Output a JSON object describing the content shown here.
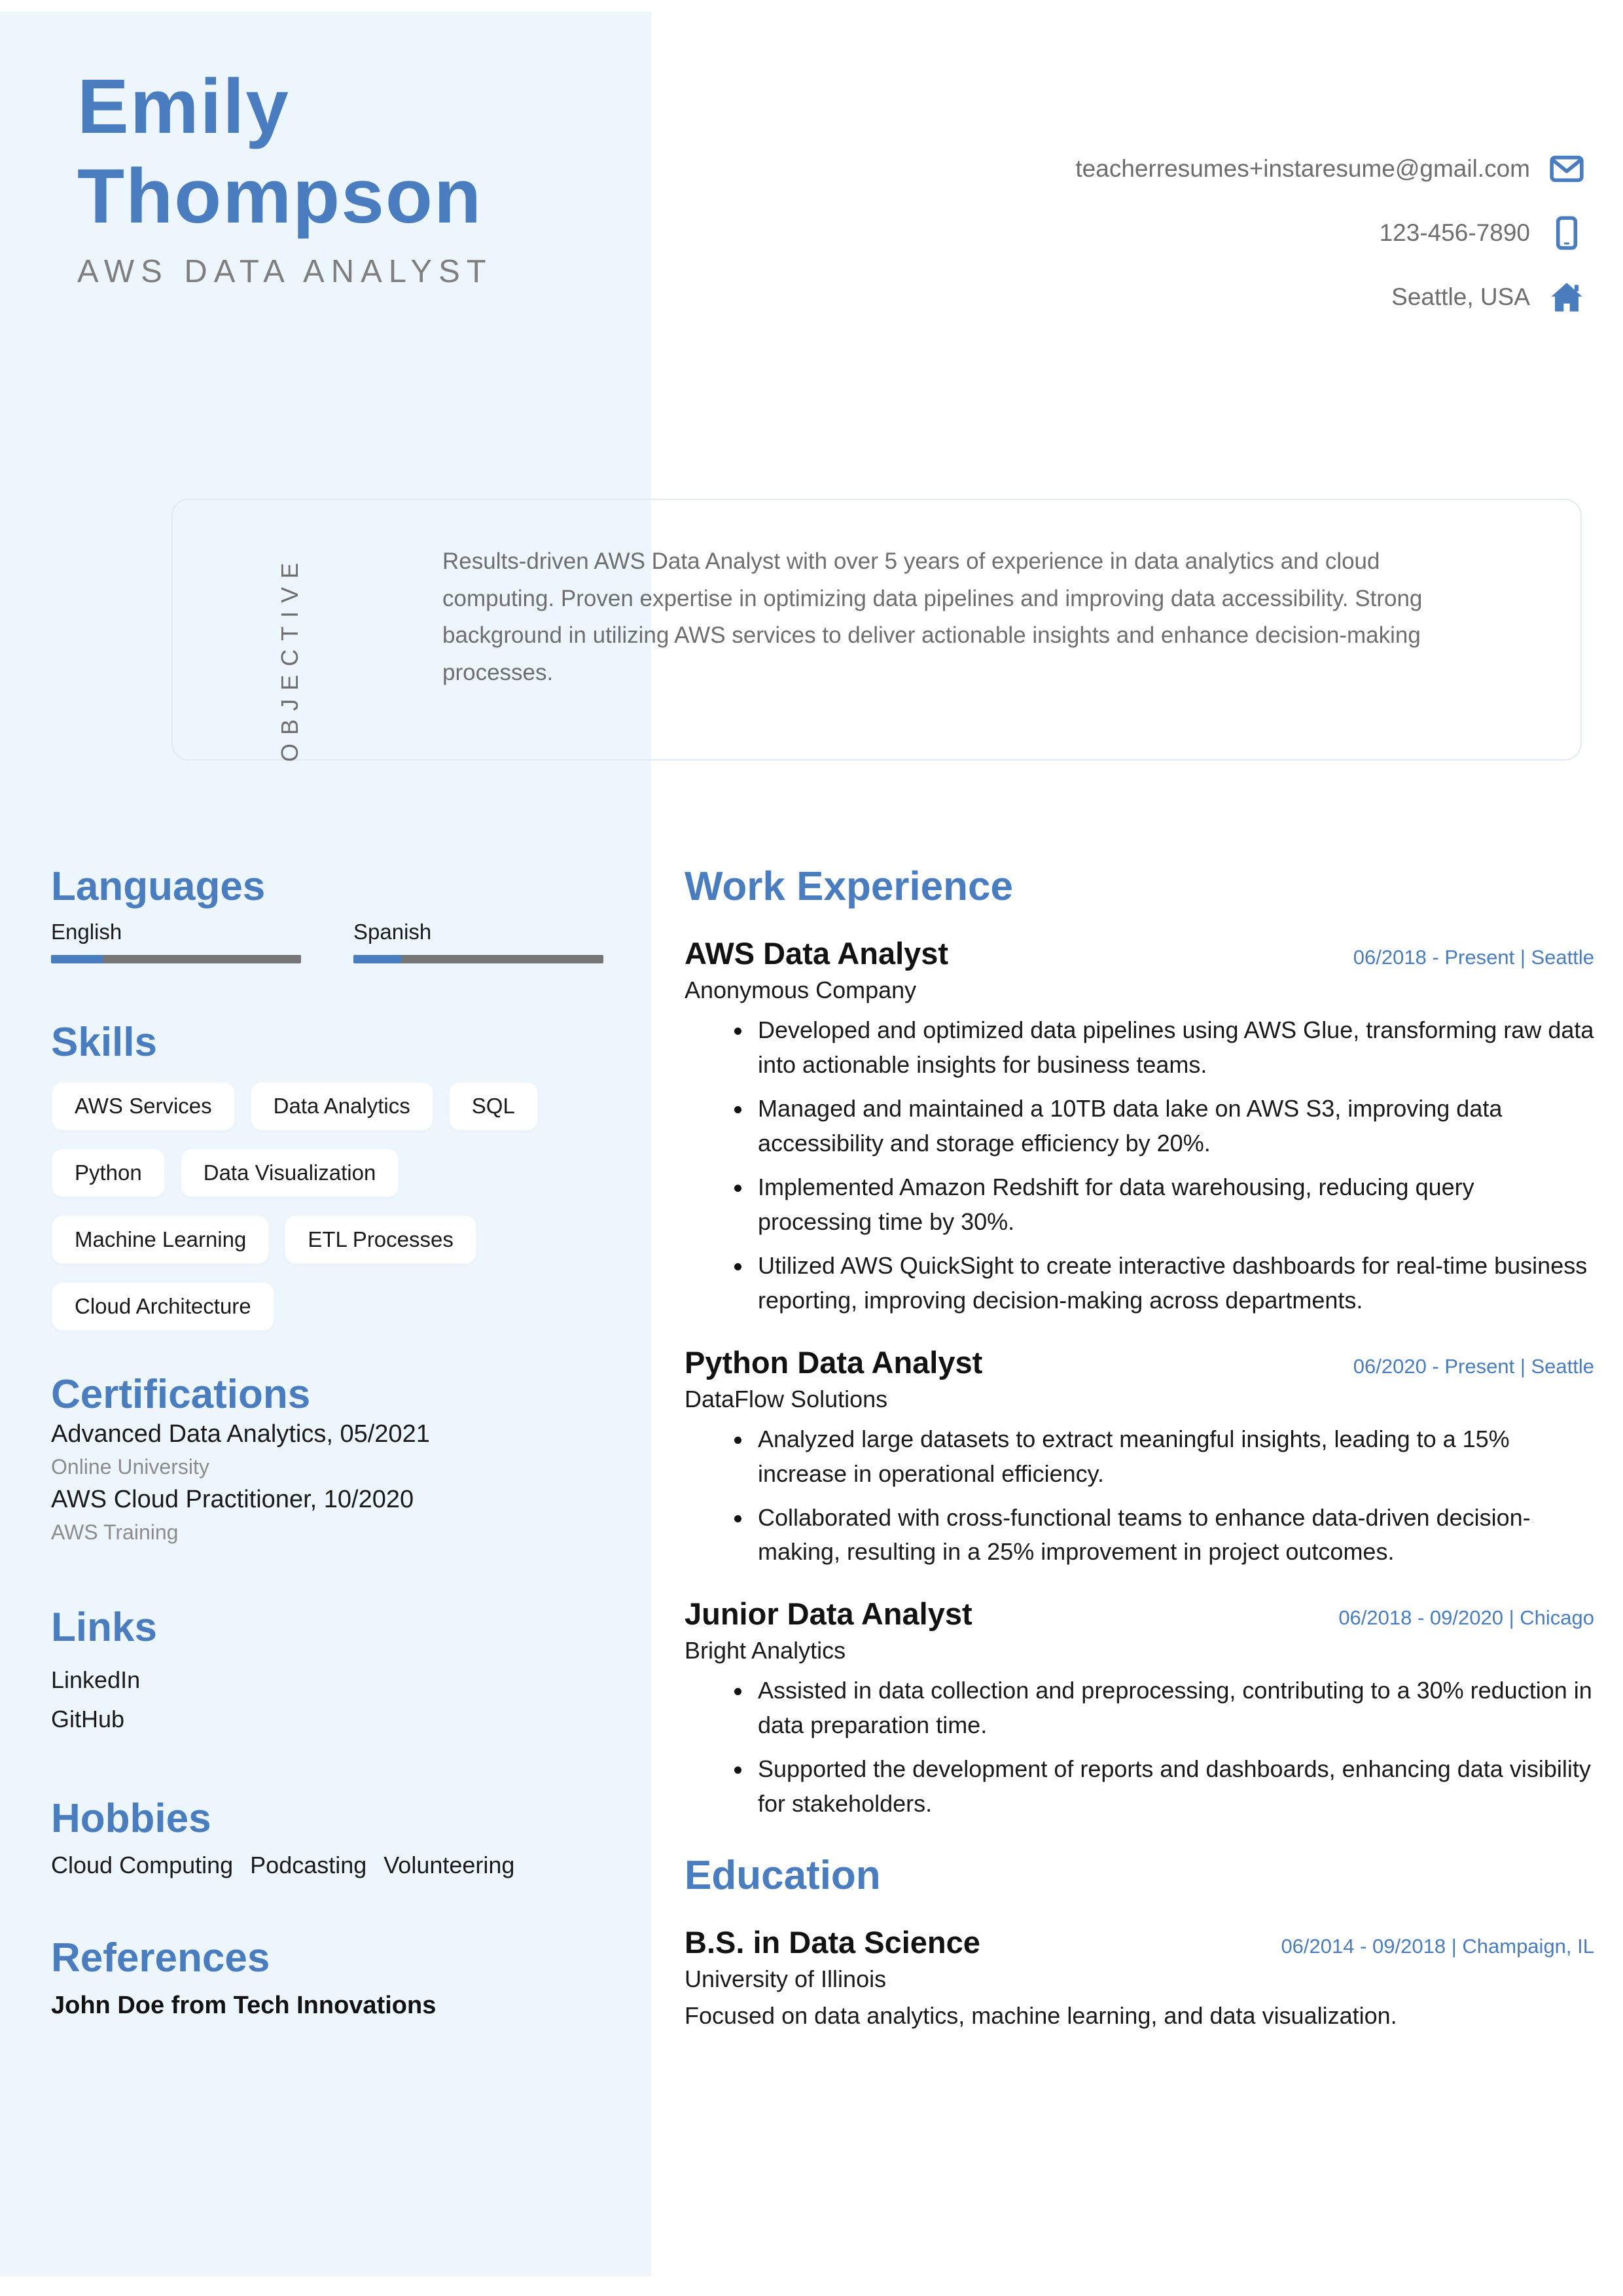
{
  "theme": {
    "accent": "#4a7dbf",
    "sidebar_bg": "#eef6fd",
    "muted_text": "#6e6e6e",
    "bar_track": "#767676"
  },
  "header": {
    "first_name": "Emily",
    "last_name": "Thompson",
    "job_title": "AWS DATA ANALYST",
    "contact": [
      {
        "icon": "envelope-icon",
        "text": "teacherresumes+instaresume@gmail.com"
      },
      {
        "icon": "mobile-phone-icon",
        "text": "123-456-7890"
      },
      {
        "icon": "home-icon",
        "text": "Seattle, USA"
      }
    ]
  },
  "objective": {
    "label": "OBJECTIVE",
    "text": "Results-driven AWS Data Analyst with over 5 years of experience in data analytics and cloud computing. Proven expertise in optimizing data pipelines and improving data accessibility. Strong background in utilizing AWS services to deliver actionable insights and enhance decision-making processes."
  },
  "sidebar": {
    "languages": {
      "heading": "Languages",
      "items": [
        {
          "name": "English",
          "level_percent": 21
        },
        {
          "name": "Spanish",
          "level_percent": 19
        }
      ]
    },
    "skills": {
      "heading": "Skills",
      "items": [
        "AWS Services",
        "Data Analytics",
        "SQL",
        "Python",
        "Data Visualization",
        "Machine Learning",
        "ETL Processes",
        "Cloud Architecture"
      ]
    },
    "certifications": {
      "heading": "Certifications",
      "items": [
        {
          "title": "Advanced Data Analytics, 05/2021",
          "org": "Online University"
        },
        {
          "title": "AWS Cloud Practitioner, 10/2020",
          "org": "AWS Training"
        }
      ]
    },
    "links": {
      "heading": "Links",
      "items": [
        "LinkedIn",
        "GitHub"
      ]
    },
    "hobbies": {
      "heading": "Hobbies",
      "items": [
        "Cloud Computing",
        "Podcasting",
        "Volunteering"
      ]
    },
    "references": {
      "heading": "References",
      "items": [
        "John Doe from Tech Innovations"
      ]
    }
  },
  "main": {
    "work": {
      "heading": "Work Experience",
      "jobs": [
        {
          "role": "AWS Data Analyst",
          "meta": "06/2018 - Present | Seattle",
          "company": "Anonymous Company",
          "bullets": [
            "Developed and optimized data pipelines using AWS Glue, transforming raw data into actionable insights for business teams.",
            "Managed and maintained a 10TB data lake on AWS S3, improving data accessibility and storage efficiency by 20%.",
            "Implemented Amazon Redshift for data warehousing, reducing query processing time by 30%.",
            "Utilized AWS QuickSight to create interactive dashboards for real-time business reporting, improving decision-making across departments."
          ]
        },
        {
          "role": "Python Data Analyst",
          "meta": "06/2020 - Present | Seattle",
          "company": "DataFlow Solutions",
          "bullets": [
            "Analyzed large datasets to extract meaningful insights, leading to a 15% increase in operational efficiency.",
            "Collaborated with cross-functional teams to enhance data-driven decision-making, resulting in a 25% improvement in project outcomes."
          ]
        },
        {
          "role": "Junior Data Analyst",
          "meta": "06/2018 - 09/2020 | Chicago",
          "company": "Bright Analytics",
          "bullets": [
            "Assisted in data collection and preprocessing, contributing to a 30% reduction in data preparation time.",
            "Supported the development of reports and dashboards, enhancing data visibility for stakeholders."
          ]
        }
      ]
    },
    "education": {
      "heading": "Education",
      "items": [
        {
          "degree": "B.S. in Data Science",
          "meta": "06/2014 - 09/2018 | Champaign, IL",
          "school": "University of Illinois",
          "description": "Focused on data analytics, machine learning, and data visualization."
        }
      ]
    }
  }
}
